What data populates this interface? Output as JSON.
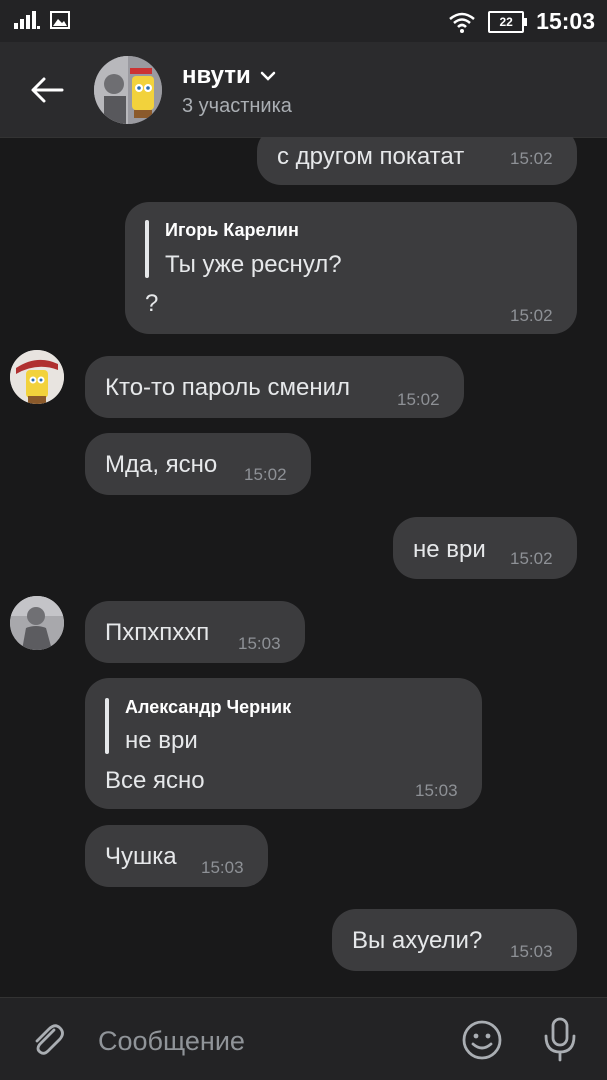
{
  "status_bar": {
    "time": "15:03",
    "battery_level": "22"
  },
  "header": {
    "title": "нвути",
    "subtitle": "3 участника"
  },
  "messages": [
    {
      "text": "с другом покатат",
      "time": "15:02"
    },
    {
      "reply_author": "Игорь Карелин",
      "reply_text": "Ты уже реснул?",
      "text": "?",
      "time": "15:02"
    },
    {
      "text": "Кто-то пароль сменил",
      "time": "15:02"
    },
    {
      "text": "Мда, ясно",
      "time": "15:02"
    },
    {
      "text": "не ври",
      "time": "15:02"
    },
    {
      "text": "Пхпхпххп",
      "time": "15:03"
    },
    {
      "reply_author": "Александр Черник",
      "reply_text": "не ври",
      "text": "Все ясно",
      "time": "15:03"
    },
    {
      "text": "Чушка",
      "time": "15:03"
    },
    {
      "text": "Вы ахуели?",
      "time": "15:03"
    }
  ],
  "composer": {
    "placeholder": "Сообщение"
  },
  "colors": {
    "background": "#19191a",
    "bubble": "#3c3c3e",
    "header": "#2b2b2d"
  }
}
